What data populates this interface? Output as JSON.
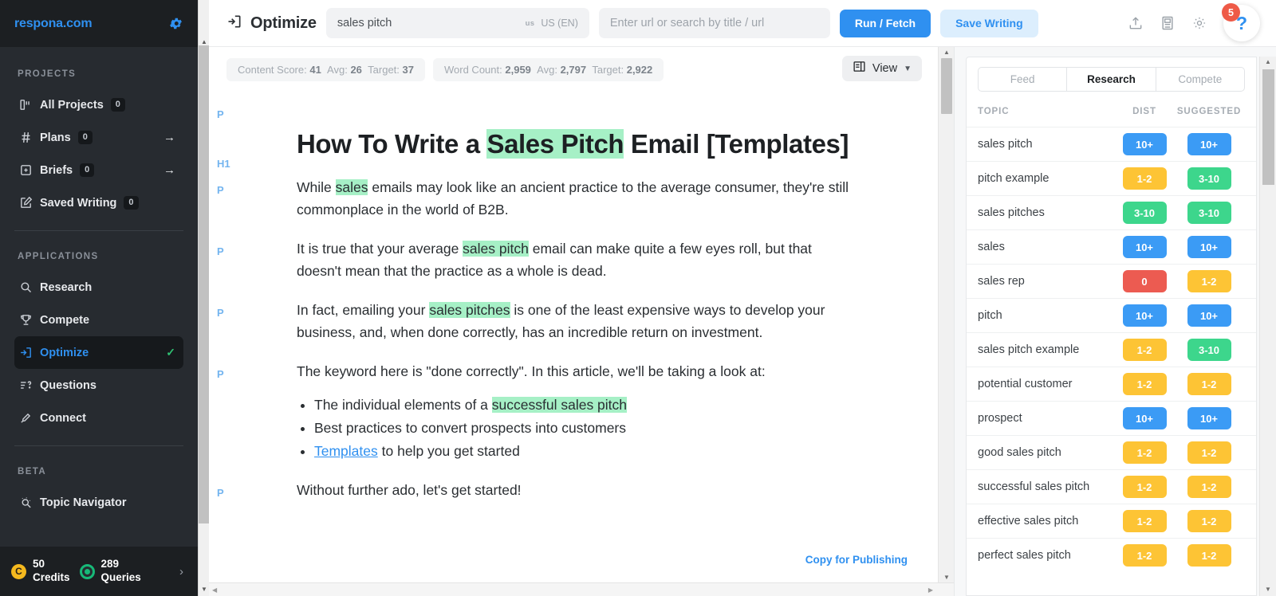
{
  "sidebar": {
    "brand": "respona.com",
    "gear_icon": "gear-icon",
    "sections": [
      {
        "label": "PROJECTS",
        "items": [
          {
            "icon": "all-projects-icon",
            "label": "All Projects",
            "count": "0",
            "arrow": "",
            "active": false
          },
          {
            "icon": "hash-icon",
            "label": "Plans",
            "count": "0",
            "arrow": "→",
            "active": false
          },
          {
            "icon": "brief-icon",
            "label": "Briefs",
            "count": "0",
            "arrow": "→",
            "active": false
          },
          {
            "icon": "edit-square-icon",
            "label": "Saved Writing",
            "count": "0",
            "arrow": "",
            "active": false
          }
        ]
      },
      {
        "label": "APPLICATIONS",
        "items": [
          {
            "icon": "search-icon",
            "label": "Research",
            "count": "",
            "arrow": "",
            "active": false
          },
          {
            "icon": "trophy-icon",
            "label": "Compete",
            "count": "",
            "arrow": "",
            "active": false
          },
          {
            "icon": "optimize-icon",
            "label": "Optimize",
            "count": "",
            "arrow": "",
            "active": true,
            "check": "✓"
          },
          {
            "icon": "questions-icon",
            "label": "Questions",
            "count": "",
            "arrow": "",
            "active": false
          },
          {
            "icon": "connect-icon",
            "label": "Connect",
            "count": "",
            "arrow": "",
            "active": false
          }
        ]
      },
      {
        "label": "BETA",
        "items": [
          {
            "icon": "topic-navigator-icon",
            "label": "Topic Navigator",
            "count": "",
            "arrow": "",
            "active": false
          }
        ]
      }
    ],
    "footer": {
      "credits_value": "50",
      "credits_label": "Credits",
      "queries_value": "289",
      "queries_label": "Queries",
      "chevron": "›"
    }
  },
  "topbar": {
    "app_icon": "optimize-icon",
    "title": "Optimize",
    "keyword_value": "sales pitch",
    "locale_abbr": "us",
    "locale_label": "US (EN)",
    "url_placeholder": "Enter url or search by title / url",
    "url_value": "",
    "run_label": "Run / Fetch",
    "save_label": "Save Writing",
    "icons": [
      "upload-icon",
      "document-layout-icon",
      "settings-gear-icon"
    ],
    "help_glyph": "?",
    "help_badge": "5"
  },
  "stats": {
    "content_score": {
      "label": "Content Score:",
      "value": "41",
      "avg_label": "Avg:",
      "avg_value": "26",
      "target_label": "Target:",
      "target_value": "37"
    },
    "word_count": {
      "label": "Word Count:",
      "value": "2,959",
      "avg_label": "Avg:",
      "avg_value": "2,797",
      "target_label": "Target:",
      "target_value": "2,922"
    },
    "view_label": "View",
    "view_chevron": "⌄",
    "view_icon": "layout-icon"
  },
  "document": {
    "blocks": [
      {
        "tag": "P",
        "type": "spacer"
      },
      {
        "tag": "H1",
        "type": "h1",
        "parts": [
          {
            "t": "How To Write a ",
            "h": false
          },
          {
            "t": "Sales Pitch",
            "h": true
          },
          {
            "t": " Email [Templates]",
            "h": false
          }
        ]
      },
      {
        "tag": "P",
        "type": "p",
        "parts": [
          {
            "t": "While ",
            "h": false
          },
          {
            "t": "sales",
            "h": true
          },
          {
            "t": " emails may look like an ancient practice to the average consumer, they're still commonplace in the world of B2B.",
            "h": false
          }
        ]
      },
      {
        "tag": "P",
        "type": "p",
        "parts": [
          {
            "t": "It is true that your average ",
            "h": false
          },
          {
            "t": "sales pitch",
            "h": true
          },
          {
            "t": " email can make quite a few eyes roll, but that doesn't mean that the practice as a whole is dead.",
            "h": false
          }
        ]
      },
      {
        "tag": "P",
        "type": "p",
        "parts": [
          {
            "t": "In fact, emailing your ",
            "h": false
          },
          {
            "t": "sales pitches",
            "h": true
          },
          {
            "t": " is one of the least expensive ways to develop your business, and, when done correctly, has an incredible return on investment.",
            "h": false
          }
        ]
      },
      {
        "tag": "P",
        "type": "p",
        "parts": [
          {
            "t": "The keyword here is \"done correctly\". In this article, we'll be taking a look at:",
            "h": false
          }
        ]
      },
      {
        "tag": "",
        "type": "ul",
        "items": [
          [
            {
              "t": "The individual elements of a ",
              "h": false
            },
            {
              "t": "successful sales pitch",
              "h": true
            }
          ],
          [
            {
              "t": "Best practices to convert prospects into customers",
              "h": false
            }
          ],
          [
            {
              "t": "Templates",
              "h": false,
              "link": true
            },
            {
              "t": " to help you get started",
              "h": false
            }
          ]
        ]
      },
      {
        "tag": "P",
        "type": "p",
        "parts": [
          {
            "t": "Without further ado, let's get started!",
            "h": false
          }
        ]
      }
    ],
    "copy_for_publishing": "Copy for Publishing"
  },
  "right_panel": {
    "tabs": [
      {
        "label": "Feed",
        "active": false
      },
      {
        "label": "Research",
        "active": true
      },
      {
        "label": "Compete",
        "active": false
      }
    ],
    "columns": {
      "topic": "TOPIC",
      "dist": "DIST",
      "suggested": "SUGGESTED"
    },
    "rows": [
      {
        "topic": "sales pitch",
        "dist": "10+",
        "dist_color": "#3B9BF5",
        "suggested": "10+",
        "suggested_color": "#3B9BF5"
      },
      {
        "topic": "pitch example",
        "dist": "1-2",
        "dist_color": "#FDC435",
        "suggested": "3-10",
        "suggested_color": "#3DD68C"
      },
      {
        "topic": "sales pitches",
        "dist": "3-10",
        "dist_color": "#3DD68C",
        "suggested": "3-10",
        "suggested_color": "#3DD68C"
      },
      {
        "topic": "sales",
        "dist": "10+",
        "dist_color": "#3B9BF5",
        "suggested": "10+",
        "suggested_color": "#3B9BF5"
      },
      {
        "topic": "sales rep",
        "dist": "0",
        "dist_color": "#EC5B51",
        "suggested": "1-2",
        "suggested_color": "#FDC435"
      },
      {
        "topic": "pitch",
        "dist": "10+",
        "dist_color": "#3B9BF5",
        "suggested": "10+",
        "suggested_color": "#3B9BF5"
      },
      {
        "topic": "sales pitch example",
        "dist": "1-2",
        "dist_color": "#FDC435",
        "suggested": "3-10",
        "suggested_color": "#3DD68C"
      },
      {
        "topic": "potential customer",
        "dist": "1-2",
        "dist_color": "#FDC435",
        "suggested": "1-2",
        "suggested_color": "#FDC435"
      },
      {
        "topic": "prospect",
        "dist": "10+",
        "dist_color": "#3B9BF5",
        "suggested": "10+",
        "suggested_color": "#3B9BF5"
      },
      {
        "topic": "good sales pitch",
        "dist": "1-2",
        "dist_color": "#FDC435",
        "suggested": "1-2",
        "suggested_color": "#FDC435"
      },
      {
        "topic": "successful sales pitch",
        "dist": "1-2",
        "dist_color": "#FDC435",
        "suggested": "1-2",
        "suggested_color": "#FDC435"
      },
      {
        "topic": "effective sales pitch",
        "dist": "1-2",
        "dist_color": "#FDC435",
        "suggested": "1-2",
        "suggested_color": "#FDC435"
      },
      {
        "topic": "perfect sales pitch",
        "dist": "1-2",
        "dist_color": "#FDC435",
        "suggested": "1-2",
        "suggested_color": "#FDC435"
      }
    ]
  },
  "colors": {
    "accent_blue": "#2F90F0",
    "badge_blue": "#3B9BF5",
    "badge_yellow": "#FDC435",
    "badge_green": "#3DD68C",
    "badge_red": "#EC5B51",
    "highlight_green": "#A6F0C6",
    "sidebar_bg": "#272B30",
    "notification_red": "#EE5A47"
  }
}
